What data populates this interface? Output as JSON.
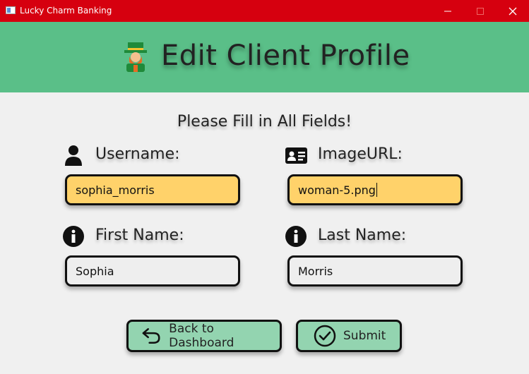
{
  "window": {
    "title": "Lucky Charm Banking",
    "minimize_icon": "minimize-icon",
    "maximize_icon": "maximize-icon",
    "close_icon": "close-icon"
  },
  "header": {
    "title": "Edit Client Profile",
    "icon": "leprechaun-icon"
  },
  "form": {
    "instruction": "Please Fill in All Fields!",
    "username": {
      "label": "Username:",
      "value": "sophia_morris",
      "icon": "user-icon"
    },
    "image_url": {
      "label": "ImageURL:",
      "value": "woman-5.png",
      "icon": "id-card-icon"
    },
    "first_name": {
      "label": "First Name:",
      "value": "Sophia",
      "icon": "info-icon"
    },
    "last_name": {
      "label": "Last Name:",
      "value": "Morris",
      "icon": "info-icon"
    }
  },
  "buttons": {
    "back": {
      "label": "Back to Dashboard",
      "icon": "undo-arrow-icon"
    },
    "submit": {
      "label": "Submit",
      "icon": "check-circle-icon"
    }
  },
  "colors": {
    "titlebar": "#d6000f",
    "header": "#5abf88",
    "highlight_field": "#ffd26a",
    "button": "#93d4b0",
    "background": "#f0f0f0"
  }
}
